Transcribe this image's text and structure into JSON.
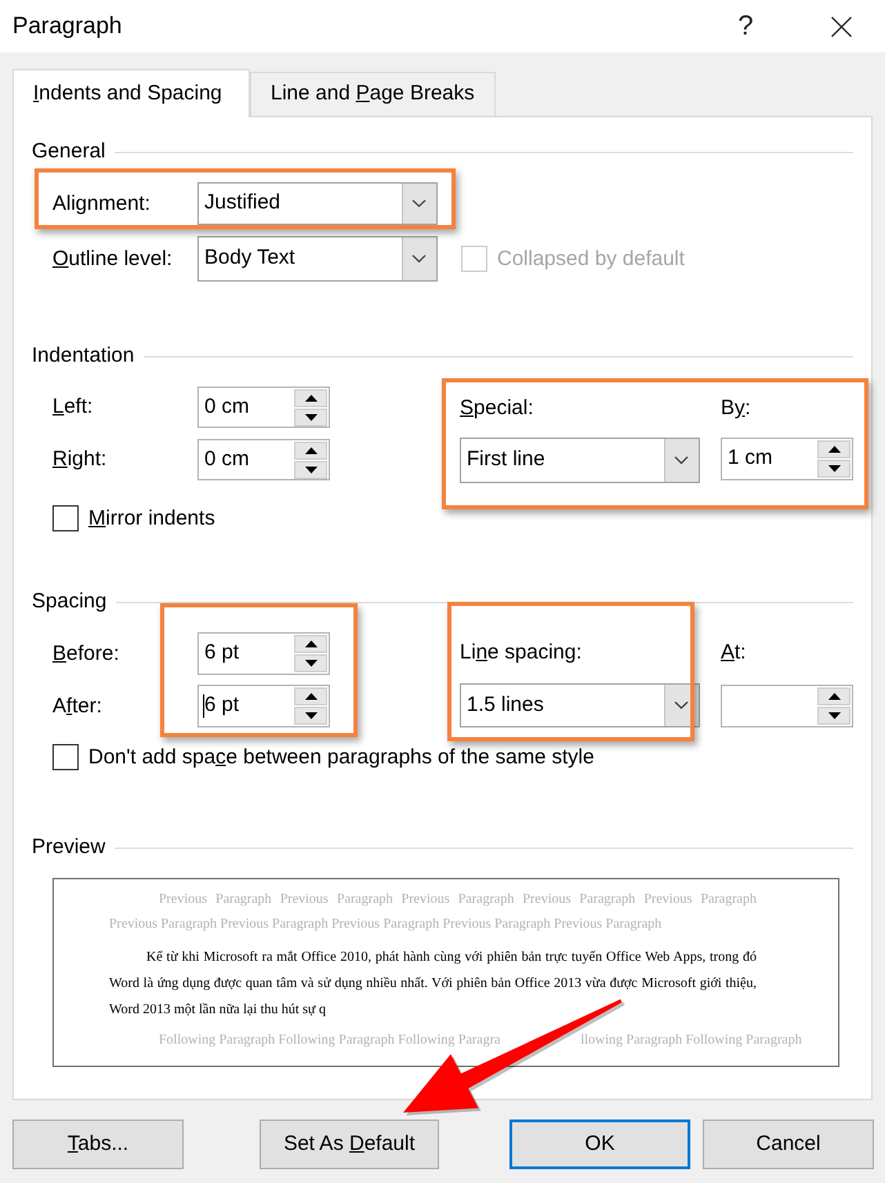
{
  "window": {
    "title": "Paragraph",
    "help_button": "?"
  },
  "tabs": [
    {
      "access_key": "I",
      "label_after": "ndents and Spacing",
      "selected": true
    },
    {
      "label_before": "Line and ",
      "access_key": "P",
      "label_after": "age Breaks",
      "selected": false
    }
  ],
  "general": {
    "heading": "General",
    "alignment": {
      "label_before": "Ali",
      "access_key": "g",
      "label_after": "nment:",
      "value": "Justified",
      "highlighted": true
    },
    "outline_level": {
      "access_key": "O",
      "label_after": "utline level:",
      "value": "Body Text"
    },
    "collapsed_by_default": {
      "label": "Collapsed by default",
      "checked": false,
      "disabled": true
    }
  },
  "indentation": {
    "heading": "Indentation",
    "left": {
      "access_key": "L",
      "label_after": "eft:",
      "value": "0 cm"
    },
    "right": {
      "access_key": "R",
      "label_after": "ight:",
      "value": "0 cm"
    },
    "special_group": {
      "highlighted": true,
      "special": {
        "access_key": "S",
        "label_after": "pecial:",
        "value": "First line"
      },
      "by": {
        "label_before": "B",
        "access_key": "y",
        "label_after": ":",
        "value": "1 cm"
      }
    },
    "mirror_indents": {
      "access_key": "M",
      "label_after": "irror indents",
      "checked": false
    }
  },
  "spacing": {
    "heading": "Spacing",
    "before_after": {
      "highlighted": true,
      "before": {
        "access_key": "B",
        "label_after": "efore:",
        "value": "6 pt",
        "focused": false
      },
      "after": {
        "label_before": "A",
        "access_key": "f",
        "label_after": "ter:",
        "value": "6 pt",
        "focused": true
      }
    },
    "line_spacing": {
      "label_before": "Li",
      "access_key": "n",
      "label_after": "e spacing:",
      "value": "1.5 lines",
      "highlighted": true
    },
    "at": {
      "access_key": "A",
      "label_after": "t:"
    },
    "dont_add_space": {
      "label_before": "Don't add spa",
      "access_key": "c",
      "label_after": "e between paragraphs of the same style",
      "checked": false
    }
  },
  "preview": {
    "heading": "Preview",
    "previous_paragraph": "Previous Paragraph Previous Paragraph Previous Paragraph Previous Paragraph Previous Paragraph Previous Paragraph Previous Paragraph Previous Paragraph Previous Paragraph Previous Paragraph",
    "paragraph": "Kể từ khi Microsoft ra mắt Office 2010, phát hành cùng với phiên bản trực tuyến Office Web Apps, trong đó Word là ứng dụng được quan tâm và sử dụng nhiều nhất. Với phiên bản Office 2013 vừa được Microsoft giới thiệu, Word 2013 một lần nữa lại thu hút sự q",
    "following_paragraph": [
      "Following Paragraph Following Paragraph Following Paragra",
      "llowing Paragraph Following Paragraph"
    ]
  },
  "buttons": [
    {
      "access_key": "T",
      "label_after": "abs...",
      "default": false
    },
    {
      "label_before": "Set As ",
      "access_key": "D",
      "label_after": "efault",
      "default": false
    },
    {
      "label": "OK",
      "default": true
    },
    {
      "label": "Cancel",
      "default": false
    }
  ],
  "pointer_arrow": true
}
